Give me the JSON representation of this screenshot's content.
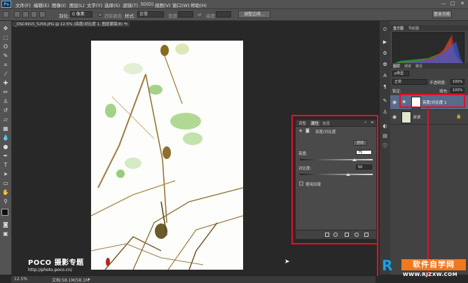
{
  "menubar": {
    "logo": "Ps",
    "items": [
      "文件(F)",
      "编辑(E)",
      "图像(I)",
      "图层(L)",
      "文字(Y)",
      "选择(S)",
      "滤镜(T)",
      "3D(D)",
      "视图(V)",
      "窗口(W)",
      "帮助(H)"
    ],
    "controls": [
      "—",
      "□",
      "✕"
    ]
  },
  "options": {
    "feather_label": "羽化:",
    "feather_value": "0 像素",
    "antialias_label": "消除锯齿",
    "style_label": "样式:",
    "style_value": "正常",
    "width_label": "宽度:",
    "height_label": "高度:",
    "refine_button": "调整边缘...",
    "workspace_button": "基本功能"
  },
  "document": {
    "tab_title": "_DSC4915_5256.JPG @ 12.5% (亮度/对比度 1, 图层蒙版/8) *",
    "close": "×"
  },
  "statusbar": {
    "zoom": "12.5%",
    "doc_info": "文档:58.1M/58.1M"
  },
  "watermark": {
    "poco_title": "POCO 摄影专题",
    "poco_url": "http://photo.poco.cn/"
  },
  "properties": {
    "tabs": [
      "调整",
      "属性",
      "信息"
    ],
    "active_tab": "属性",
    "title": "亮度/对比度",
    "auto_button": "自动",
    "brightness_label": "亮度:",
    "brightness_value": "75",
    "contrast_label": "对比度:",
    "contrast_value": "50",
    "legacy_label": "使用旧版"
  },
  "histogram_panel": {
    "tabs": [
      "直方图",
      "导航器"
    ]
  },
  "layers_panel": {
    "tabs": [
      "图层",
      "通道",
      "路径"
    ],
    "kind_label": "ρ类型",
    "blend_mode": "正常",
    "opacity_label": "不透明度:",
    "opacity_value": "100%",
    "lock_label": "锁定:",
    "fill_label": "填充:",
    "fill_value": "100%",
    "layers": [
      {
        "name": "亮度/对比度 1"
      },
      {
        "name": "背景"
      }
    ]
  },
  "logo_site": {
    "mark": "R",
    "name": "软件自学网",
    "url": "WWW.RJZXW.COM"
  },
  "colors": {
    "highlight": "#e0122a",
    "logo_orange": "#f0781e",
    "logo_blue": "#1aa0e6"
  }
}
